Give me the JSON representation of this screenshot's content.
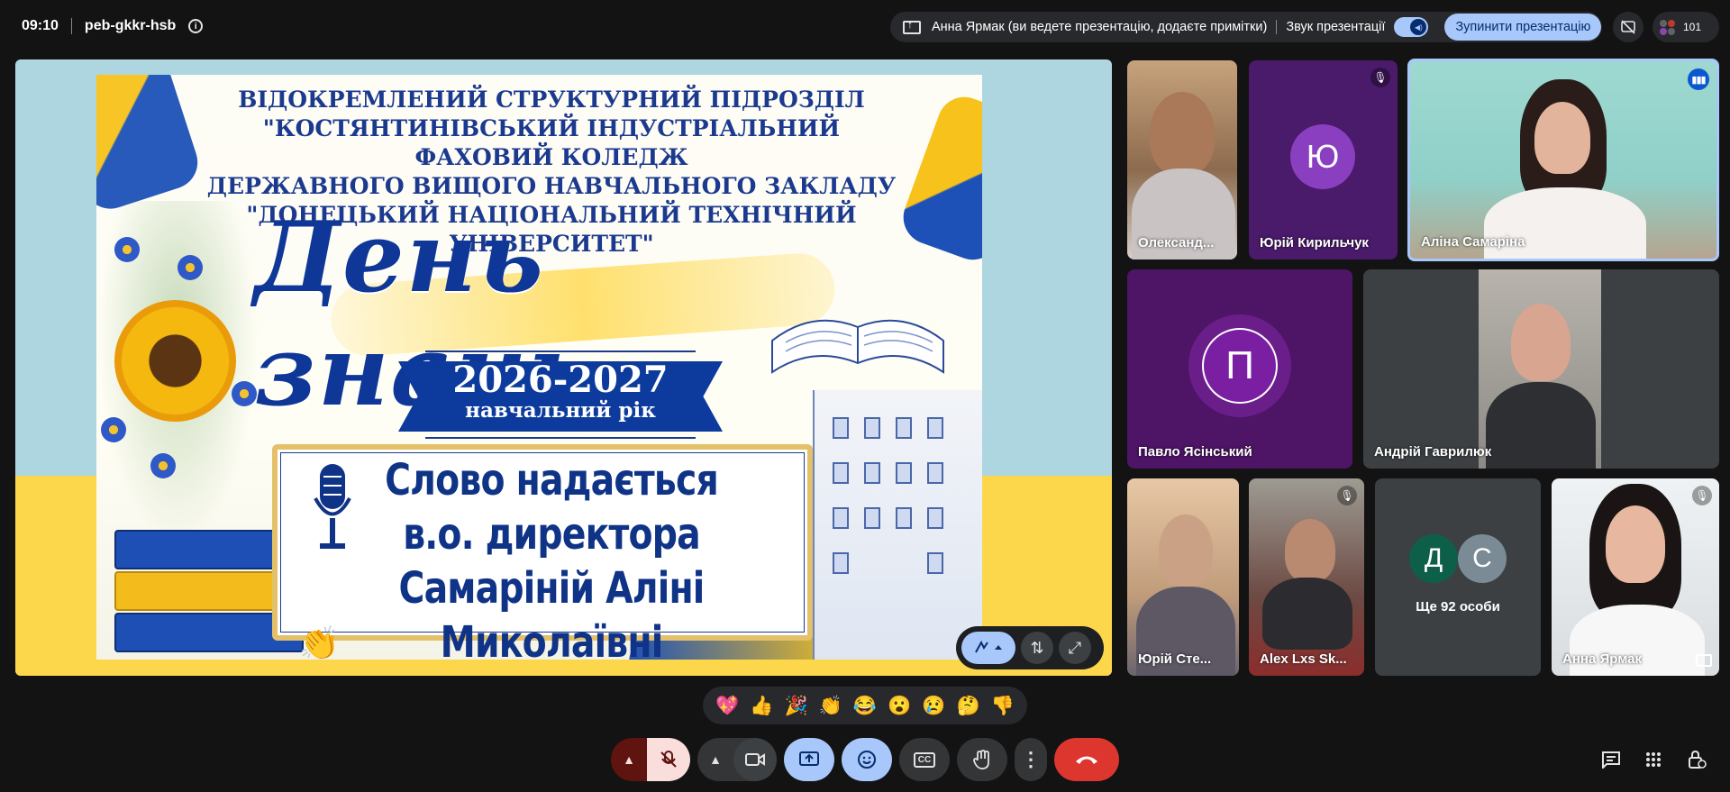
{
  "meeting": {
    "time": "09:10",
    "code": "peb-gkkr-hsb",
    "info_icon": "info-icon"
  },
  "presentation_bar": {
    "status": "Анна Ярмак (ви ведете презентацію, додаєте примітки)",
    "sound_label": "Звук презентації",
    "sound_on": true,
    "stop_label": "Зупинити презентацію"
  },
  "participants_count": "101",
  "slide": {
    "header_lines": [
      "ВІДОКРЕМЛЕНИЙ СТРУКТУРНИЙ ПІДРОЗДІЛ",
      "\"КОСТЯНТИНІВСЬКИЙ ІНДУСТРІАЛЬНИЙ ФАХОВИЙ КОЛЕДЖ",
      "ДЕРЖАВНОГО ВИЩОГО НАВЧАЛЬНОГО ЗАКЛАДУ",
      "\"ДОНЕЦЬКИЙ НАЦІОНАЛЬНИЙ ТЕХНІЧНИЙ УНІВЕРСИТЕТ\""
    ],
    "title": "День знань",
    "year": "2026-2027",
    "year_sub": "навчальний рік",
    "speech_lines": [
      "Слово надається",
      "в.о. директора",
      "Самаріній Аліні Миколаївні"
    ],
    "reaction_overlay": "👏"
  },
  "tiles": [
    {
      "name": "Олександ...",
      "type": "video"
    },
    {
      "name": "Юрій Кирильчук",
      "type": "avatar",
      "initial": "Ю",
      "bg": "#4a1a6b",
      "avatar_bg": "#8a3fc0",
      "muted": true
    },
    {
      "name": "Аліна Самаріна",
      "type": "video",
      "speaking": true
    },
    {
      "name": "Павло Ясінський",
      "type": "avatar",
      "initial": "П",
      "bg": "#4e1466",
      "avatar_bg": "#7b1fa2"
    },
    {
      "name": "Андрій Гаврилюк",
      "type": "video"
    },
    {
      "name": "Юрій Сте...",
      "type": "video"
    },
    {
      "name": "Alex Lxs Sk...",
      "type": "video",
      "muted": true
    },
    {
      "name": "Ще 92 особи",
      "type": "more",
      "initials": [
        "Д",
        "С"
      ]
    },
    {
      "name": "Анна Ярмак",
      "type": "video",
      "muted": true
    }
  ],
  "reactions": [
    "💖",
    "👍",
    "🎉",
    "👏",
    "😂",
    "😮",
    "😢",
    "🤔",
    "👎"
  ],
  "controls": {
    "mic": "mic-off-icon",
    "camera": "camera-icon",
    "present": "present-icon",
    "emoji": "emoji-icon",
    "captions": "CC",
    "hand": "hand-icon",
    "more": "more-icon",
    "leave": "end-call-icon"
  },
  "colors": {
    "accent": "#a8c7fa",
    "leave": "#dc362e",
    "mic_bg": "#f9dedc"
  }
}
